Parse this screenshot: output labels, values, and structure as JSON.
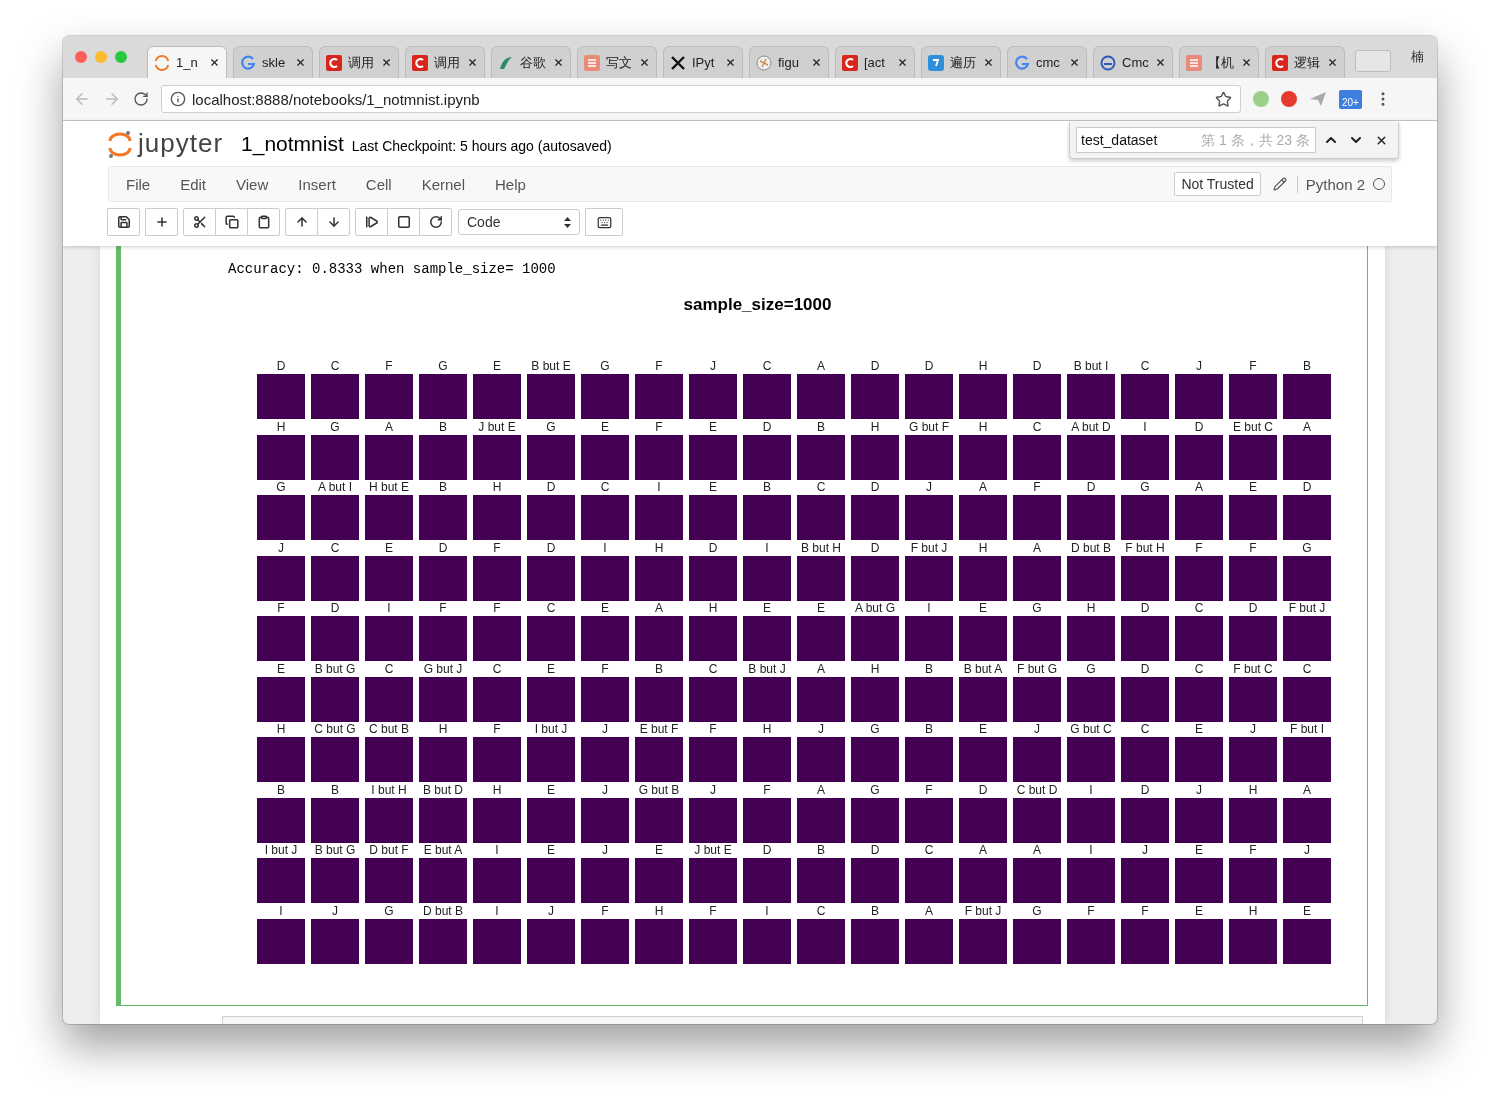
{
  "browser": {
    "tabs": [
      {
        "label": "1_n",
        "kind": "ring",
        "selected": true
      },
      {
        "label": "skle",
        "kind": "g",
        "selected": false
      },
      {
        "label": "调用",
        "kind": "c",
        "selected": false
      },
      {
        "label": "调用",
        "kind": "c",
        "selected": false
      },
      {
        "label": "谷歌",
        "kind": "bird",
        "selected": false
      },
      {
        "label": "写文",
        "kind": "square",
        "selected": false
      },
      {
        "label": "IPyt",
        "kind": "x",
        "selected": false
      },
      {
        "label": "figu",
        "kind": "ball",
        "selected": false
      },
      {
        "label": "[act",
        "kind": "c",
        "selected": false
      },
      {
        "label": "遍历",
        "kind": "cube",
        "selected": false
      },
      {
        "label": "cmc",
        "kind": "g",
        "selected": false
      },
      {
        "label": "Cmc",
        "kind": "swirl",
        "selected": false
      },
      {
        "label": "【机",
        "kind": "square",
        "selected": false
      },
      {
        "label": "逻辑",
        "kind": "c",
        "selected": false
      }
    ],
    "profile": "楠",
    "url": "localhost:8888/notebooks/1_notmnist.ipynb",
    "extension_badge": "20+"
  },
  "jupyter": {
    "logo": "jupyter",
    "notebook": "1_notmnist",
    "checkpoint": "Last Checkpoint: 5 hours ago (autosaved)",
    "menu": [
      "File",
      "Edit",
      "View",
      "Insert",
      "Cell",
      "Kernel",
      "Help"
    ],
    "trust": "Not Trusted",
    "kernel": "Python 2",
    "kernel_busy": false,
    "cell_type": "Code"
  },
  "find_bar": {
    "query": "test_dataset",
    "count": "第 1 条，共 23 条"
  },
  "output": {
    "text": "Accuracy: 0.8333 when sample_size= 1000",
    "figure": {
      "title": "sample_size=1000",
      "rows": [
        [
          "D",
          "C",
          "F",
          "G",
          "E",
          "B but E",
          "G",
          "F",
          "J",
          "C",
          "A",
          "D",
          "D",
          "H",
          "D",
          "B but I",
          "C",
          "J",
          "F",
          "B"
        ],
        [
          "H",
          "G",
          "A",
          "B",
          "J but E",
          "G",
          "E",
          "F",
          "E",
          "D",
          "B",
          "H",
          "G but F",
          "H",
          "C",
          "A but D",
          "I",
          "D",
          "E but C",
          "A"
        ],
        [
          "G",
          "A but I",
          "H but E",
          "B",
          "H",
          "D",
          "C",
          "I",
          "E",
          "B",
          "C",
          "D",
          "J",
          "A",
          "F",
          "D",
          "G",
          "A",
          "E",
          "D"
        ],
        [
          "J",
          "C",
          "E",
          "D",
          "F",
          "D",
          "I",
          "H",
          "D",
          "I",
          "B but H",
          "D",
          "F but J",
          "H",
          "A",
          "D but B",
          "F but H",
          "F",
          "F",
          "G"
        ],
        [
          "F",
          "D",
          "I",
          "F",
          "F",
          "C",
          "E",
          "A",
          "H",
          "E",
          "E",
          "A but G",
          "I",
          "E",
          "G",
          "H",
          "D",
          "C",
          "D",
          "F but J"
        ],
        [
          "E",
          "B but G",
          "C",
          "G but J",
          "C",
          "E",
          "F",
          "B",
          "C",
          "B but J",
          "A",
          "H",
          "B",
          "B but A",
          "F but G",
          "G",
          "D",
          "C",
          "F but C",
          "C"
        ],
        [
          "H",
          "C but G",
          "C but B",
          "H",
          "F",
          "I but J",
          "J",
          "E but F",
          "F",
          "H",
          "J",
          "G",
          "B",
          "E",
          "J",
          "G but C",
          "C",
          "E",
          "J",
          "F but I"
        ],
        [
          "B",
          "B",
          "I but H",
          "B but D",
          "H",
          "E",
          "J",
          "G but B",
          "J",
          "F",
          "A",
          "G",
          "F",
          "D",
          "C but D",
          "I",
          "D",
          "J",
          "H",
          "A"
        ],
        [
          "I but J",
          "B but G",
          "D but F",
          "E but A",
          "I",
          "E",
          "J",
          "E",
          "J but E",
          "D",
          "B",
          "D",
          "C",
          "A",
          "A",
          "I",
          "J",
          "E",
          "F",
          "J"
        ],
        [
          "I",
          "J",
          "G",
          "D but B",
          "I",
          "J",
          "F",
          "H",
          "F",
          "I",
          "C",
          "B",
          "A",
          "F but J",
          "G",
          "F",
          "F",
          "E",
          "H",
          "E"
        ]
      ]
    }
  }
}
